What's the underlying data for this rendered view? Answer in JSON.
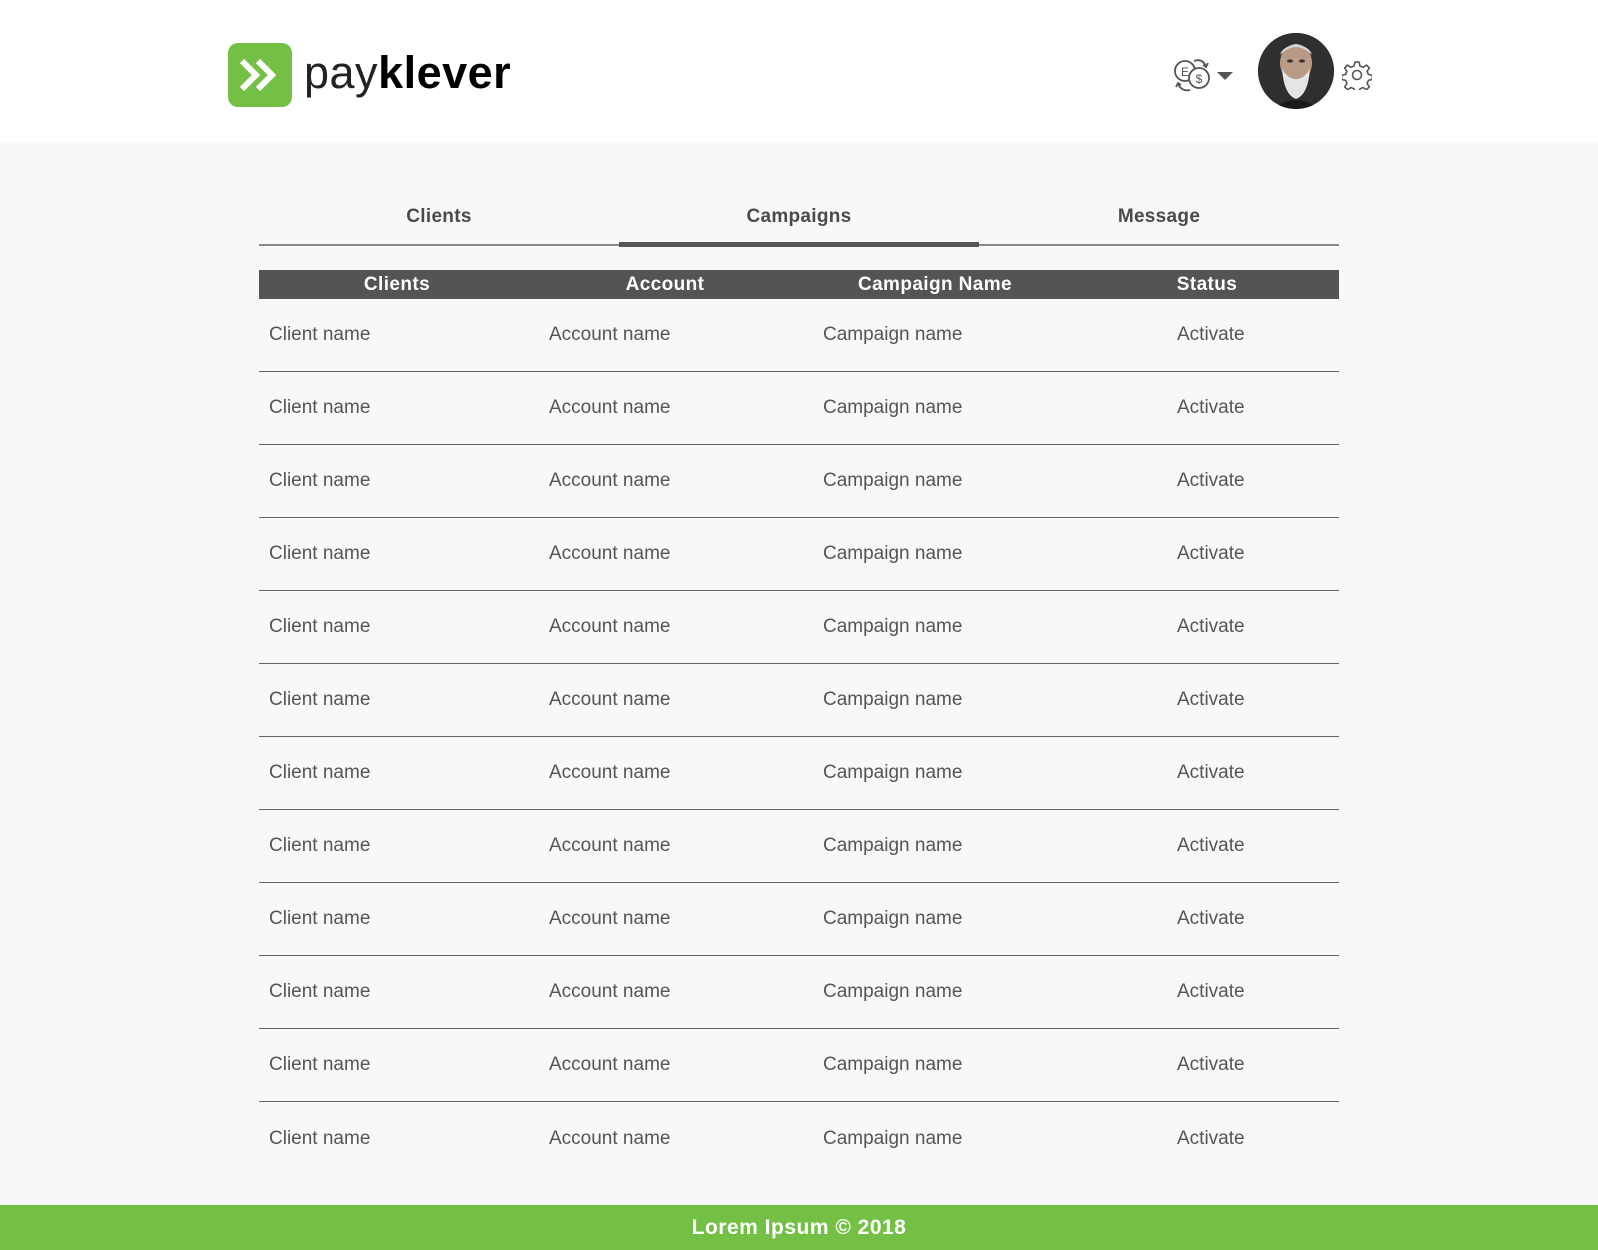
{
  "brand": {
    "name_light": "pay",
    "name_bold": "klever",
    "color": "#74c044"
  },
  "header": {
    "currency_icon": "currency-exchange-icon",
    "currency_letters": [
      "E",
      "$"
    ],
    "avatar_icon": "user-avatar",
    "settings_icon": "gear-icon"
  },
  "tabs": [
    {
      "label": "Clients",
      "active": false
    },
    {
      "label": "Campaigns",
      "active": true
    },
    {
      "label": "Message",
      "active": false
    }
  ],
  "table": {
    "headers": {
      "clients": "Clients",
      "account": "Account",
      "campaign": "Campaign Name",
      "status": "Status"
    },
    "rows": [
      {
        "client": "Client name",
        "account": "Account name",
        "campaign": "Campaign name",
        "status": "Activate"
      },
      {
        "client": "Client name",
        "account": "Account name",
        "campaign": "Campaign name",
        "status": "Activate"
      },
      {
        "client": "Client name",
        "account": "Account name",
        "campaign": "Campaign name",
        "status": "Activate"
      },
      {
        "client": "Client name",
        "account": "Account name",
        "campaign": "Campaign name",
        "status": "Activate"
      },
      {
        "client": "Client name",
        "account": "Account name",
        "campaign": "Campaign name",
        "status": "Activate"
      },
      {
        "client": "Client name",
        "account": "Account name",
        "campaign": "Campaign name",
        "status": "Activate"
      },
      {
        "client": "Client name",
        "account": "Account name",
        "campaign": "Campaign name",
        "status": "Activate"
      },
      {
        "client": "Client name",
        "account": "Account name",
        "campaign": "Campaign name",
        "status": "Activate"
      },
      {
        "client": "Client name",
        "account": "Account name",
        "campaign": "Campaign name",
        "status": "Activate"
      },
      {
        "client": "Client name",
        "account": "Account name",
        "campaign": "Campaign name",
        "status": "Activate"
      },
      {
        "client": "Client name",
        "account": "Account name",
        "campaign": "Campaign name",
        "status": "Activate"
      },
      {
        "client": "Client name",
        "account": "Account name",
        "campaign": "Campaign name",
        "status": "Activate"
      }
    ]
  },
  "footer": {
    "text": "Lorem Ipsum  ©  2018"
  }
}
